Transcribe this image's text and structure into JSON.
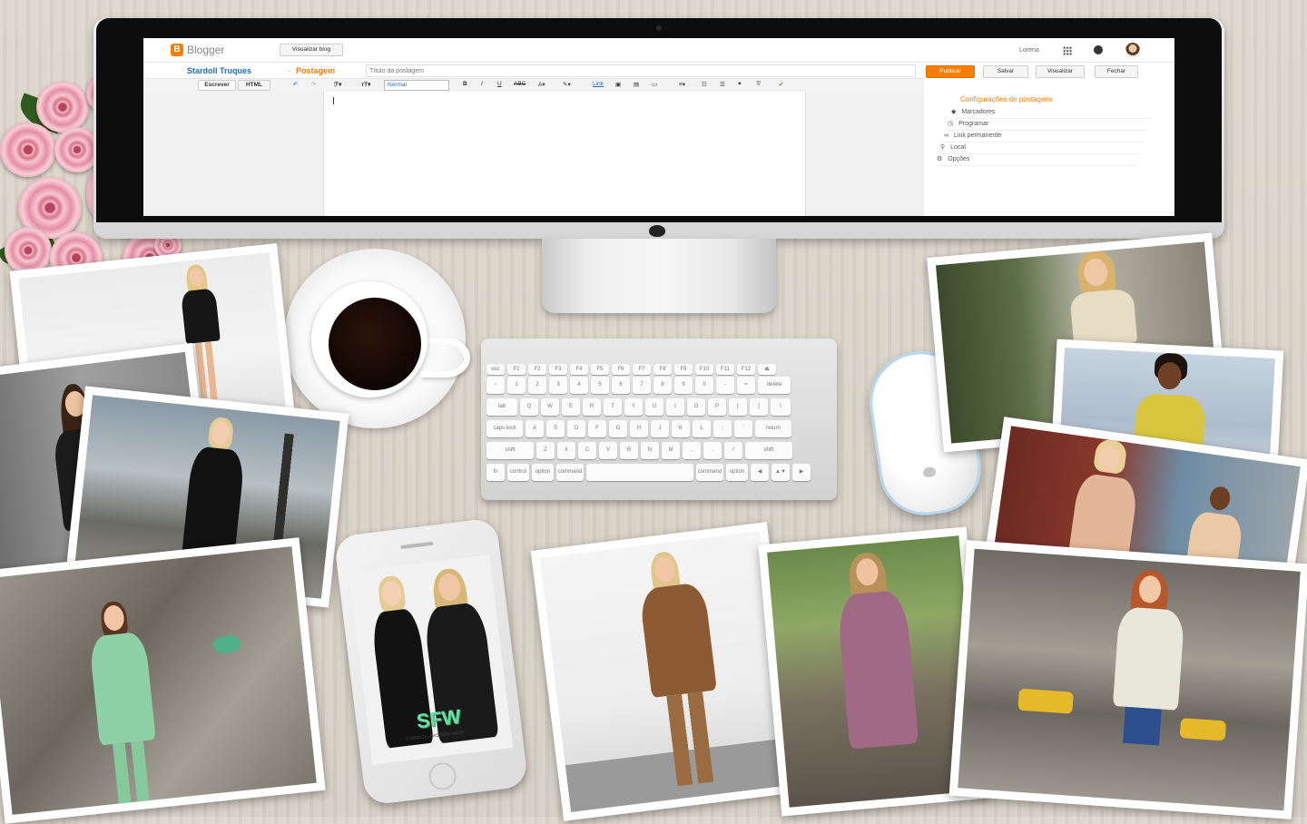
{
  "blogger": {
    "logo_text": "Blogger",
    "view_blog_button": "Visualizar blog",
    "user_name": "Lorena",
    "blog_name": "Stardoll Truques",
    "separator": "·",
    "section": "Postagem",
    "title_placeholder": "Título da postagem",
    "publish_button": "Publicar",
    "save_button": "Salvar",
    "preview_button": "Visualizar",
    "close_button": "Fechar",
    "compose_tab": "Escrever",
    "html_tab": "HTML",
    "font_size_select": "Normal",
    "link_button": "Link",
    "post_settings_title": "Configurações de postagens",
    "settings_items": [
      "Marcadores",
      "Programar",
      "Link permanente",
      "Local",
      "Opções"
    ]
  },
  "keyboard": {
    "row1": [
      "esc",
      "F1",
      "F2",
      "F3",
      "F4",
      "F5",
      "F6",
      "F7",
      "F8",
      "F9",
      "F10",
      "F11",
      "F12",
      "⏏"
    ],
    "row2": [
      "~",
      "1",
      "2",
      "3",
      "4",
      "5",
      "6",
      "7",
      "8",
      "9",
      "0",
      "-",
      "=",
      "delete"
    ],
    "row3": [
      "tab",
      "Q",
      "W",
      "E",
      "R",
      "T",
      "Y",
      "U",
      "I",
      "O",
      "P",
      "[",
      "]",
      "\\"
    ],
    "row4": [
      "caps lock",
      "A",
      "S",
      "D",
      "F",
      "G",
      "H",
      "J",
      "K",
      "L",
      ";",
      "'",
      "return"
    ],
    "row5": [
      "shift",
      "Z",
      "X",
      "C",
      "V",
      "B",
      "N",
      "M",
      ",",
      ".",
      "/",
      "shift"
    ],
    "row6": [
      "fn",
      "control",
      "option",
      "command",
      "",
      "command",
      "option",
      "◀",
      "▲▼",
      "▶"
    ]
  },
  "phone": {
    "logo_text": "SFW",
    "caption": "STARDOLL FASHION WEEK"
  },
  "colors": {
    "blogger_orange": "#f57d00",
    "desk": "#d8d1c6",
    "rose": "#e58fa2"
  }
}
